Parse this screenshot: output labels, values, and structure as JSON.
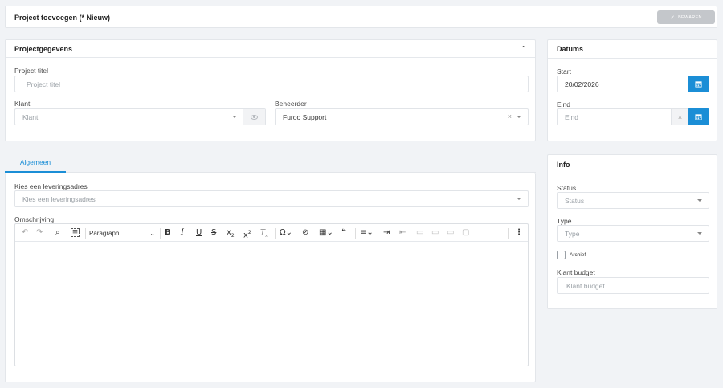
{
  "header": {
    "title": "Project toevoegen (* Nieuw)",
    "save_label": "BEWAREN"
  },
  "projectgegevens": {
    "title": "Projectgegevens",
    "project_titel": {
      "label": "Project titel",
      "placeholder": "Project titel"
    },
    "klant": {
      "label": "Klant",
      "placeholder": "Klant"
    },
    "beheerder": {
      "label": "Beheerder",
      "value": "Furoo Support"
    }
  },
  "datums": {
    "title": "Datums",
    "start": {
      "label": "Start",
      "value": "20/02/2026"
    },
    "eind": {
      "label": "Eind",
      "placeholder": "Eind"
    }
  },
  "tabs": [
    {
      "label": "Algemeen",
      "active": true
    }
  ],
  "algemeen": {
    "leveringsadres": {
      "label": "Kies een leveringsadres",
      "placeholder": "Kies een leveringsadres"
    },
    "omschrijving": {
      "label": "Omschrijving"
    },
    "editor": {
      "block_format": "Paragraph"
    }
  },
  "info": {
    "title": "Info",
    "status": {
      "label": "Status",
      "placeholder": "Status"
    },
    "type": {
      "label": "Type",
      "placeholder": "Type"
    },
    "archief": {
      "label": "Archief",
      "checked": false
    },
    "klant_budget": {
      "label": "Klant budget",
      "placeholder": "Klant budget"
    }
  },
  "colors": {
    "accent": "#1b8ed6",
    "save_disabled": "#c4c7cb"
  }
}
